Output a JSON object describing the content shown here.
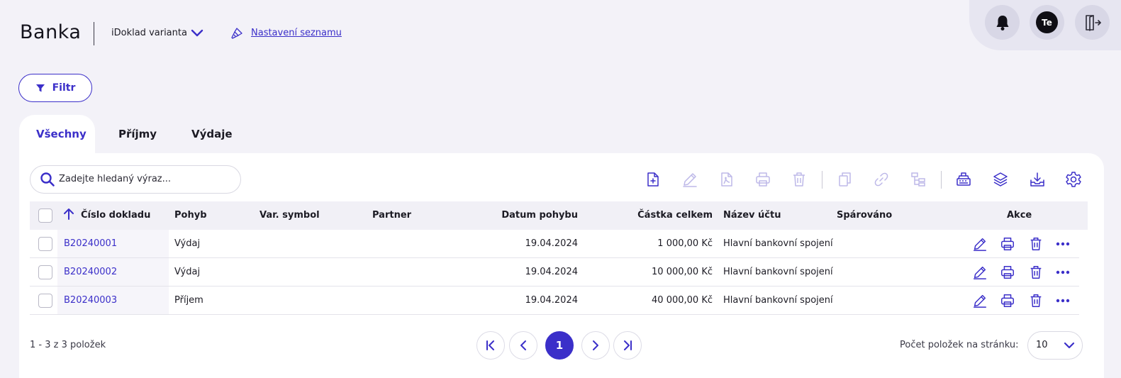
{
  "header": {
    "title": "Banka",
    "variant_label": "iDoklad varianta",
    "settings_link": "Nastavení seznamu",
    "avatar_initials": "Te"
  },
  "filter": {
    "label": "Filtr"
  },
  "tabs": [
    {
      "label": "Všechny",
      "active": true
    },
    {
      "label": "Příjmy",
      "active": false
    },
    {
      "label": "Výdaje",
      "active": false
    }
  ],
  "search": {
    "placeholder": "Zadejte hledaný výraz..."
  },
  "toolbar": {
    "icons": [
      "new-document-icon",
      "edit-icon",
      "pdf-icon",
      "print-icon",
      "delete-icon",
      "copy-icon",
      "link-icon",
      "tree-icon",
      "cash-register-icon",
      "layers-icon",
      "download-icon",
      "settings-icon"
    ]
  },
  "table": {
    "columns": {
      "cislo": "Číslo dokladu",
      "pohyb": "Pohyb",
      "varsymbol": "Var. symbol",
      "partner": "Partner",
      "datum": "Datum pohybu",
      "castka": "Částka celkem",
      "ucet": "Název účtu",
      "sparovano": "Spárováno",
      "akce": "Akce"
    },
    "sort": {
      "column": "cislo",
      "direction": "ascending"
    },
    "rows": [
      {
        "cislo": "B20240001",
        "pohyb": "Výdaj",
        "varsymbol": "",
        "partner": "",
        "datum": "19.04.2024",
        "castka": "1 000,00 Kč",
        "ucet": "Hlavní bankovní spojení",
        "sparovano": ""
      },
      {
        "cislo": "B20240002",
        "pohyb": "Výdaj",
        "varsymbol": "",
        "partner": "",
        "datum": "19.04.2024",
        "castka": "10 000,00 Kč",
        "ucet": "Hlavní bankovní spojení",
        "sparovano": ""
      },
      {
        "cislo": "B20240003",
        "pohyb": "Příjem",
        "varsymbol": "",
        "partner": "",
        "datum": "19.04.2024",
        "castka": "40 000,00 Kč",
        "ucet": "Hlavní bankovní spojení",
        "sparovano": ""
      }
    ]
  },
  "pagination": {
    "info": "1 - 3 z 3 položek",
    "current_page": "1",
    "per_page_label": "Počet položek na stránku:",
    "per_page_value": "10"
  },
  "colors": {
    "accent": "#3b2fc9",
    "background": "#f3f2f8",
    "header_row": "#f1f0f6"
  }
}
